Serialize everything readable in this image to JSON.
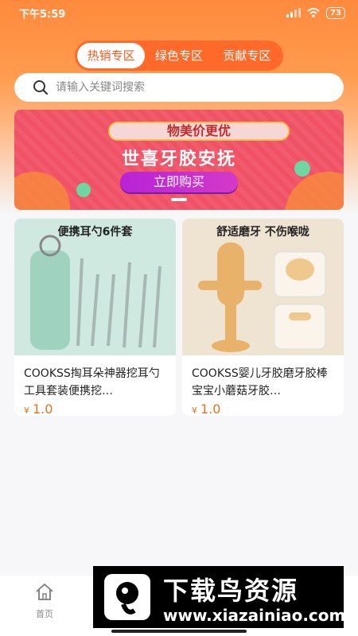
{
  "status_bar": {
    "time": "下午5:59",
    "battery": "73"
  },
  "tabs": [
    {
      "label": "热销专区",
      "active": true
    },
    {
      "label": "绿色专区",
      "active": false
    },
    {
      "label": "贡献专区",
      "active": false
    }
  ],
  "search": {
    "placeholder": "请输入关键词搜索",
    "icon": "search-icon"
  },
  "banner": {
    "subtitle": "物美价更优",
    "title": "世喜牙胶安抚",
    "button": "立即购买"
  },
  "products": [
    {
      "image_caption": "便携耳勺6件套",
      "title": "COOKSS掏耳朵神器挖耳勺工具套装便携挖…",
      "price_symbol": "¥",
      "price": "1.0"
    },
    {
      "image_caption": "舒适磨牙 不伤喉咙",
      "title": "COOKSS婴儿牙胶磨牙胶棒宝宝小蘑菇牙胶…",
      "price_symbol": "¥",
      "price": "1.0"
    }
  ],
  "tabbar": {
    "home_label": "首页"
  },
  "watermark": {
    "title": "下载鸟资源",
    "url": "www.xiazainiao.com"
  },
  "colors": {
    "accent": "#ff6a2a",
    "price": "#e6731f"
  }
}
